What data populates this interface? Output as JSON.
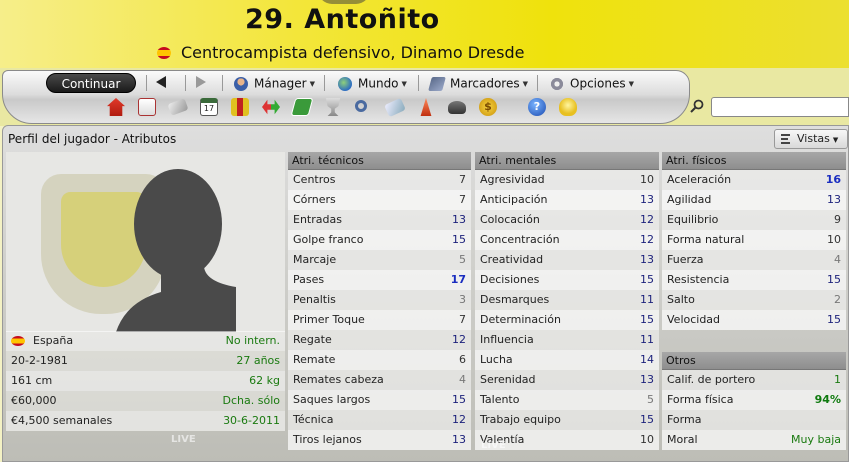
{
  "header": {
    "name": "29. Antoñito",
    "subtitle": "Centrocampista defensivo, Dinamo Dresde"
  },
  "toolbar": {
    "continue_label": "Continuar",
    "menus": [
      {
        "label": "Mánager",
        "icon": "manager-icon"
      },
      {
        "label": "Mundo",
        "icon": "globe-icon"
      },
      {
        "label": "Marcadores",
        "icon": "bookmarks-icon"
      },
      {
        "label": "Opciones",
        "icon": "options-icon"
      }
    ],
    "icons": [
      "home-icon",
      "mail-icon",
      "notebook-icon",
      "calendar-icon",
      "squad-icon",
      "transfer-icon",
      "tactics-icon",
      "trophy-icon",
      "search-players-icon",
      "news-icon",
      "training-icon",
      "scouting-icon",
      "finances-icon",
      "help-icon",
      "tip-icon"
    ]
  },
  "panel": {
    "title": "Perfil del jugador - Atributos",
    "views_label": "Vistas"
  },
  "info": [
    {
      "left": "España",
      "right": "No intern."
    },
    {
      "left": "20-2-1981",
      "right": "27 años"
    },
    {
      "left": "161 cm",
      "right": "62 kg"
    },
    {
      "left": "€60,000",
      "right": "Dcha. sólo"
    },
    {
      "left": "€4,500 semanales",
      "right": "30-6-2011"
    }
  ],
  "technical": {
    "title": "Atri. técnicos",
    "rows": [
      {
        "name": "Centros",
        "value": "7"
      },
      {
        "name": "Córners",
        "value": "7"
      },
      {
        "name": "Entradas",
        "value": "13"
      },
      {
        "name": "Golpe franco",
        "value": "15"
      },
      {
        "name": "Marcaje",
        "value": "5"
      },
      {
        "name": "Pases",
        "value": "17"
      },
      {
        "name": "Penaltis",
        "value": "3"
      },
      {
        "name": "Primer Toque",
        "value": "7"
      },
      {
        "name": "Regate",
        "value": "12"
      },
      {
        "name": "Remate",
        "value": "6"
      },
      {
        "name": "Remates cabeza",
        "value": "4"
      },
      {
        "name": "Saques largos",
        "value": "15"
      },
      {
        "name": "Técnica",
        "value": "12"
      },
      {
        "name": "Tiros lejanos",
        "value": "13"
      }
    ]
  },
  "mental": {
    "title": "Atri. mentales",
    "rows": [
      {
        "name": "Agresividad",
        "value": "10"
      },
      {
        "name": "Anticipación",
        "value": "13"
      },
      {
        "name": "Colocación",
        "value": "12"
      },
      {
        "name": "Concentración",
        "value": "12"
      },
      {
        "name": "Creatividad",
        "value": "13"
      },
      {
        "name": "Decisiones",
        "value": "15"
      },
      {
        "name": "Desmarques",
        "value": "11"
      },
      {
        "name": "Determinación",
        "value": "15"
      },
      {
        "name": "Influencia",
        "value": "11"
      },
      {
        "name": "Lucha",
        "value": "14"
      },
      {
        "name": "Serenidad",
        "value": "13"
      },
      {
        "name": "Talento",
        "value": "5"
      },
      {
        "name": "Trabajo equipo",
        "value": "15"
      },
      {
        "name": "Valentía",
        "value": "10"
      }
    ]
  },
  "physical": {
    "title": "Atri. físicos",
    "rows": [
      {
        "name": "Aceleración",
        "value": "16"
      },
      {
        "name": "Agilidad",
        "value": "13"
      },
      {
        "name": "Equilibrio",
        "value": "9"
      },
      {
        "name": "Forma natural",
        "value": "10"
      },
      {
        "name": "Fuerza",
        "value": "4"
      },
      {
        "name": "Resistencia",
        "value": "15"
      },
      {
        "name": "Salto",
        "value": "2"
      },
      {
        "name": "Velocidad",
        "value": "15"
      }
    ]
  },
  "others": {
    "title": "Otros",
    "rows": [
      {
        "name": "Calif. de portero",
        "value": "1"
      },
      {
        "name": "Forma física",
        "value": "94%"
      },
      {
        "name": "Forma",
        "value": ""
      },
      {
        "name": "Moral",
        "value": "Muy baja"
      }
    ]
  },
  "colors": {
    "header_yellow": "#efe20c",
    "value_blue": "#1a1f7a",
    "value_green": "#1a7a10"
  }
}
